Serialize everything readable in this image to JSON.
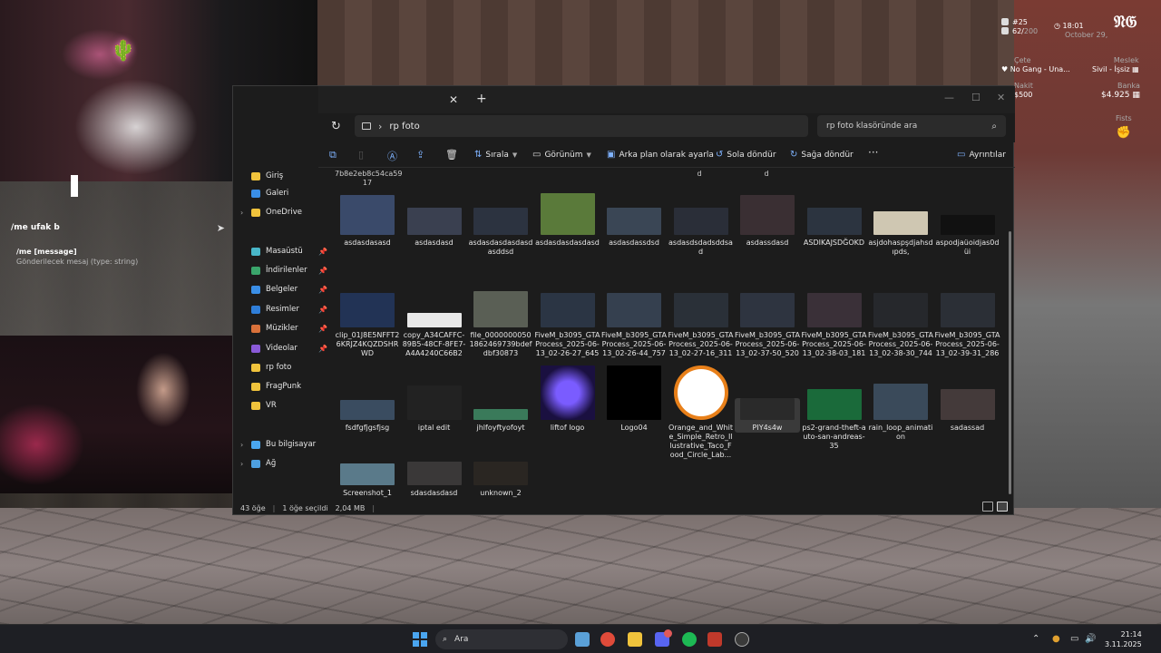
{
  "chat": {
    "input_text": "/me ufak b",
    "hint_command": "/me [message]",
    "hint_desc": "Gönderilecek mesaj (type: string)"
  },
  "hud": {
    "id_label": "#25",
    "players": "62/",
    "players_max": "200",
    "time": "18:01",
    "date": "October 29,",
    "gang_title": "Çete",
    "gang_value": "No Gang - Una...",
    "job_title": "Meslek",
    "job_value": "Sivil - İşsiz",
    "cash_title": "Nakit",
    "cash_value": "$500",
    "bank_title": "Banka",
    "bank_value": "$4.925",
    "fists": "Fists"
  },
  "explorer": {
    "path": "rp foto",
    "search_placeholder": "rp foto klasöründe ara",
    "toolbar": {
      "sort": "Sırala",
      "view": "Görünüm",
      "set_background": "Arka plan olarak ayarla",
      "rotate_left": "Sola döndür",
      "rotate_right": "Sağa döndür",
      "details": "Ayrıntılar"
    },
    "nav": [
      {
        "label": "Giriş",
        "icon": "home-icon"
      },
      {
        "label": "Galeri",
        "icon": "gallery-icon"
      },
      {
        "label": "OneDrive",
        "icon": "onedrive-icon"
      },
      {
        "label": "Masaüstü",
        "icon": "desktop-icon"
      },
      {
        "label": "İndirilenler",
        "icon": "downloads-icon"
      },
      {
        "label": "Belgeler",
        "icon": "documents-icon"
      },
      {
        "label": "Resimler",
        "icon": "pictures-icon"
      },
      {
        "label": "Müzikler",
        "icon": "music-icon"
      },
      {
        "label": "Videolar",
        "icon": "videos-icon"
      },
      {
        "label": "rp foto",
        "icon": "folder-icon"
      },
      {
        "label": "FragPunk",
        "icon": "folder-icon"
      },
      {
        "label": "VR",
        "icon": "folder-icon"
      },
      {
        "label": "Bu bilgisayar",
        "icon": "this-pc-icon"
      },
      {
        "label": "Ağ",
        "icon": "network-icon"
      }
    ],
    "top_fragments": [
      "7b8e2eb8c54ca59\n17",
      "d",
      "d"
    ],
    "files": [
      {
        "name": "asdasdasasd"
      },
      {
        "name": "asdasdasd"
      },
      {
        "name": "asdasdasdasdasdasddsd"
      },
      {
        "name": "asdasdasdasdasd"
      },
      {
        "name": "asdasdassdsd"
      },
      {
        "name": "asdasdsdadsddsad"
      },
      {
        "name": "asdassdasd"
      },
      {
        "name": "ASDIKAJSDĞOKD"
      },
      {
        "name": "asjdohaspşdjahsdıpds,"
      },
      {
        "name": "aspodjaüoidjas0düi"
      },
      {
        "name": "clip_01J8E5NFFT26KRJZ4KQZDSHRWD"
      },
      {
        "name": "copy_A34CAFFC-89B5-48CF-8FE7-A4A4240C66B2"
      },
      {
        "name": "file_00000000501862469739bdefdbf30873"
      },
      {
        "name": "FiveM_b3095_GTAProcess_2025-06-13_02-26-27_645"
      },
      {
        "name": "FiveM_b3095_GTAProcess_2025-06-13_02-26-44_757"
      },
      {
        "name": "FiveM_b3095_GTAProcess_2025-06-13_02-27-16_311"
      },
      {
        "name": "FiveM_b3095_GTAProcess_2025-06-13_02-37-50_520"
      },
      {
        "name": "FiveM_b3095_GTAProcess_2025-06-13_02-38-03_181"
      },
      {
        "name": "FiveM_b3095_GTAProcess_2025-06-13_02-38-30_744"
      },
      {
        "name": "FiveM_b3095_GTAProcess_2025-06-13_02-39-31_286"
      },
      {
        "name": "fsdfgfjgsfjsg"
      },
      {
        "name": "iptal edit"
      },
      {
        "name": "jhlfoyftyofoyt"
      },
      {
        "name": "liftof logo"
      },
      {
        "name": "Logo04"
      },
      {
        "name": "Orange_and_White_Simple_Retro_Illustrative_Taco_Food_Circle_Lab..."
      },
      {
        "name": "PIY4s4w"
      },
      {
        "name": "ps2-grand-theft-auto-san-andreas-35"
      },
      {
        "name": "rain_loop_animation"
      },
      {
        "name": "sadassad"
      },
      {
        "name": "Screenshot_1"
      },
      {
        "name": "sdasdasdasd"
      },
      {
        "name": "unknown_2"
      }
    ],
    "status": {
      "count": "43 öğe",
      "selected": "1 öğe seçildi",
      "size": "2,04 MB"
    }
  },
  "taskbar": {
    "search": "Ara",
    "time": "21:14",
    "date": "3.11.2025"
  }
}
